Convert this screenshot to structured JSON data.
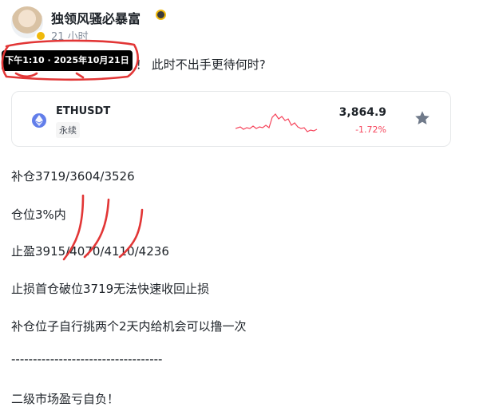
{
  "author": {
    "name": "独领风骚必暴富",
    "time": "21 小时"
  },
  "tooltip": {
    "text": "下午1:10 · 2025年10月21日"
  },
  "post": {
    "headline_tail": "！ 此时不出手更待何时?",
    "lines": [
      "补仓3719/3604/3526",
      "仓位3%内",
      "止盈3915/4070/4110/4236",
      "止损首仓破位3719无法快速收回止损",
      "补仓位子自行挑两个2天内给机会可以撸一次",
      "-----------------------------------",
      "二级市场盈亏自负！"
    ]
  },
  "ticker": {
    "symbol": "ETHUSDT",
    "type": "永续",
    "price": "3,864.9",
    "change": "-1.72%",
    "icon": "ethereum-icon"
  },
  "colors": {
    "negative": "#f6465d",
    "star": "#707a8a",
    "annotation": "#e23636",
    "eth": "#627eea"
  }
}
